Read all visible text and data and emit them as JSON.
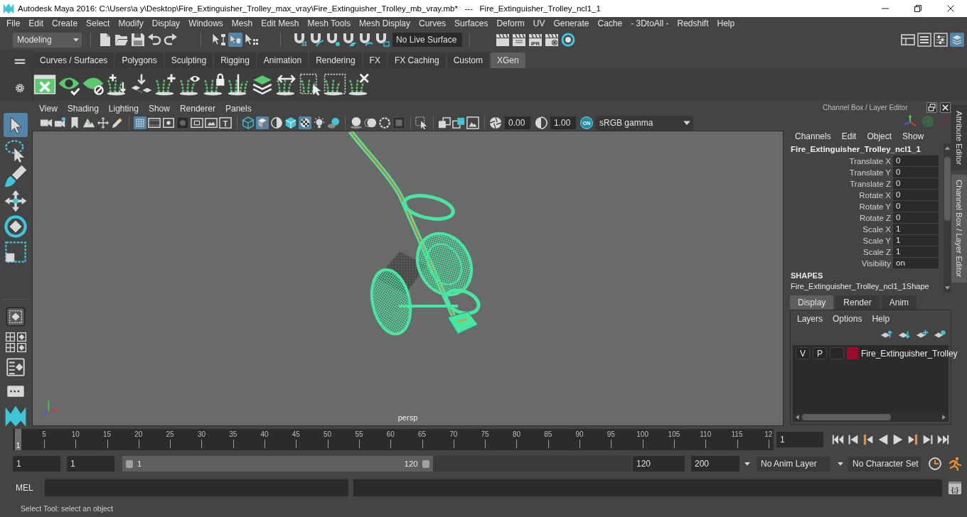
{
  "window": {
    "title": "Autodesk Maya 2016: C:\\Users\\a y\\Desktop\\Fire_Extinguisher_Trolley_max_vray\\Fire_Extinguisher_Trolley_mb_vray.mb*   ---   Fire_Extinguisher_Trolley_ncl1_1"
  },
  "menu_bar": [
    "File",
    "Edit",
    "Create",
    "Select",
    "Modify",
    "Display",
    "Windows",
    "Mesh",
    "Edit Mesh",
    "Mesh Tools",
    "Mesh Display",
    "Curves",
    "Surfaces",
    "Deform",
    "UV",
    "Generate",
    "Cache",
    "- 3DtoAll -",
    "Redshift",
    "Help"
  ],
  "status_line": {
    "mode_menu": "Modeling",
    "selection_masks": [
      {
        "kind": "hierarchy",
        "selected": false
      },
      {
        "kind": "object",
        "selected": true
      },
      {
        "kind": "component",
        "selected": false
      }
    ],
    "live_surface": "No Live Surface",
    "render_tools": [
      {
        "kind": "clapper"
      },
      {
        "kind": "clapper-seq"
      },
      {
        "kind": "ipr",
        "label": "IPR"
      },
      {
        "kind": "clapper-gear"
      },
      {
        "kind": "ring"
      }
    ],
    "panel_toggles": [
      {
        "kind": "layout",
        "selected": false
      },
      {
        "kind": "list",
        "selected": false
      },
      {
        "kind": "sliders",
        "selected": false
      },
      {
        "kind": "layers",
        "selected": true
      }
    ]
  },
  "shelf": {
    "tabs": [
      {
        "label": "Curves / Surfaces",
        "selected": false
      },
      {
        "label": "Polygons",
        "selected": false
      },
      {
        "label": "Sculpting",
        "selected": false
      },
      {
        "label": "Rigging",
        "selected": false
      },
      {
        "label": "Animation",
        "selected": false
      },
      {
        "label": "Rendering",
        "selected": false
      },
      {
        "label": "FX",
        "selected": false
      },
      {
        "label": "FX Caching",
        "selected": false
      },
      {
        "label": "Custom",
        "selected": false
      },
      {
        "label": "XGen",
        "selected": true
      }
    ]
  },
  "toolbox": {
    "tools": [
      {
        "kind": "select",
        "selected": true
      },
      {
        "kind": "lasso",
        "selected": false
      },
      {
        "kind": "paint",
        "selected": false
      },
      {
        "kind": "move",
        "selected": false
      },
      {
        "kind": "rotate",
        "selected": false
      },
      {
        "kind": "scale",
        "selected": false
      }
    ]
  },
  "viewport": {
    "menu": [
      "View",
      "Shading",
      "Lighting",
      "Show",
      "Renderer",
      "Panels"
    ],
    "toolbar_groups": [
      [
        {
          "kind": "camera",
          "selected": false
        },
        {
          "kind": "camera-lock",
          "selected": false
        },
        {
          "kind": "bookmark",
          "selected": false
        },
        {
          "kind": "image-plane",
          "selected": false
        },
        {
          "kind": "pan",
          "selected": false
        },
        {
          "kind": "pencil",
          "selected": false
        }
      ],
      [
        {
          "kind": "grid",
          "selected": true
        },
        {
          "kind": "film",
          "selected": false
        },
        {
          "kind": "resolution",
          "selected": false
        },
        {
          "kind": "gate-mask",
          "selected": false
        },
        {
          "kind": "field-chart",
          "selected": false
        },
        {
          "kind": "safe-action",
          "selected": false
        },
        {
          "kind": "safe-title",
          "label": "T",
          "selected": false
        }
      ],
      [
        {
          "kind": "cube-wire",
          "selected": false
        },
        {
          "kind": "cube-shaded",
          "selected": true
        },
        {
          "kind": "half-sphere",
          "selected": false
        },
        {
          "kind": "wire-shaded",
          "selected": false
        },
        {
          "kind": "checker",
          "selected": true
        },
        {
          "kind": "bulb",
          "selected": false
        },
        {
          "kind": "shadow",
          "selected": false
        }
      ],
      [
        {
          "kind": "ao",
          "selected": false
        },
        {
          "kind": "motion-blur",
          "selected": false
        },
        {
          "kind": "aa",
          "selected": false
        },
        {
          "kind": "isolate",
          "selected": false
        }
      ],
      [
        {
          "kind": "xray-select",
          "selected": false
        }
      ],
      [
        {
          "kind": "squares",
          "selected": false
        },
        {
          "kind": "squares-link",
          "selected": false
        },
        {
          "kind": "image-frame",
          "selected": false
        }
      ]
    ],
    "exposure": "0.00",
    "gamma": "1.00",
    "color_management": "ON",
    "color_space": "sRGB gamma",
    "camera": "persp"
  },
  "channel_box": {
    "title": "Channel Box / Layer Editor",
    "menu": [
      "Channels",
      "Edit",
      "Object",
      "Show"
    ],
    "object_name": "Fire_Extinguisher_Trolley_ncl1_1",
    "channels": [
      {
        "name": "Translate X",
        "value": "0"
      },
      {
        "name": "Translate Y",
        "value": "0"
      },
      {
        "name": "Translate Z",
        "value": "0"
      },
      {
        "name": "Rotate X",
        "value": "0"
      },
      {
        "name": "Rotate Y",
        "value": "0"
      },
      {
        "name": "Rotate Z",
        "value": "0"
      },
      {
        "name": "Scale X",
        "value": "1"
      },
      {
        "name": "Scale Y",
        "value": "1"
      },
      {
        "name": "Scale Z",
        "value": "1"
      },
      {
        "name": "Visibility",
        "value": "on"
      }
    ],
    "shapes_heading": "SHAPES",
    "shape_name": "Fire_Extinguisher_Trolley_ncl1_1Shape"
  },
  "layer_editor": {
    "tabs": [
      {
        "label": "Display",
        "selected": true
      },
      {
        "label": "Render",
        "selected": false
      },
      {
        "label": "Anim",
        "selected": false
      }
    ],
    "menu": [
      "Layers",
      "Options",
      "Help"
    ],
    "layers": [
      {
        "visibility": "V",
        "playback": "P",
        "color": "#9c0a2a",
        "name": "Fire_Extinguisher_Trolley"
      }
    ]
  },
  "side_tabs": [
    {
      "label": "Attribute Editor",
      "selected": false
    },
    {
      "label": "Channel Box / Layer Editor",
      "selected": true
    }
  ],
  "time_slider": {
    "current_frame": "1",
    "level": 0,
    "tick_labels": [
      "5",
      "10",
      "15",
      "20",
      "25",
      "30",
      "35",
      "40",
      "45",
      "50",
      "55",
      "60",
      "65",
      "70",
      "75",
      "80",
      "85",
      "90",
      "95",
      "100",
      "105",
      "110",
      "115",
      "12"
    ],
    "current_time": "1"
  },
  "range_slider": {
    "start_time": "1",
    "playback_start": "1",
    "range_start": "1",
    "range_end": "120",
    "level": 0.61,
    "playback_end": "120",
    "end_time": "200",
    "anim_layer": "No Anim Layer",
    "character_set": "No Character Set"
  },
  "command_line": {
    "language": "MEL",
    "editor_label": "{;}"
  },
  "help_line": "Select Tool: select an object"
}
